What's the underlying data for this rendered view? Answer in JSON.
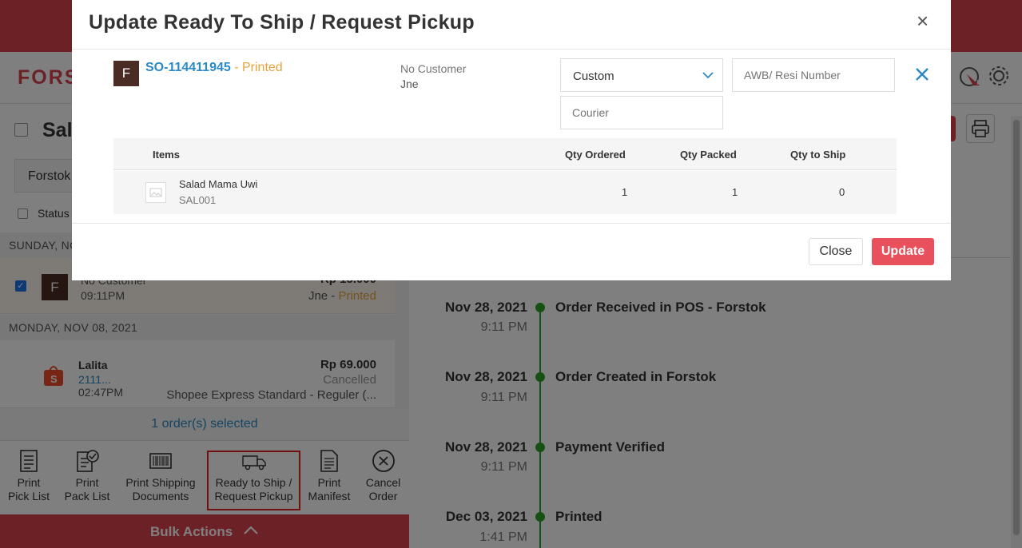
{
  "app": {
    "logo": "FORS"
  },
  "page": {
    "title": "Sal",
    "filter_value": "Forstok",
    "status_label": "Status"
  },
  "list": {
    "groups": [
      {
        "date": "SUNDAY, NC"
      },
      {
        "date": "MONDAY, NOV 08, 2021"
      }
    ],
    "orders": [
      {
        "avatar": "F",
        "customer": "No Customer",
        "time": "09:11PM",
        "amount": "Rp 15.000",
        "courier": "Jne",
        "status": "Printed"
      },
      {
        "customer": "Lalita",
        "order_id": "2111...",
        "time": "02:47PM",
        "amount": "Rp 69.000",
        "status": "Cancelled",
        "courier": "Shopee Express Standard - Reguler (..."
      }
    ],
    "selected_text": "1 order(s) selected"
  },
  "bulk": {
    "tools": [
      {
        "label1": "Print",
        "label2": "Pick List"
      },
      {
        "label1": "Print",
        "label2": "Pack List"
      },
      {
        "label1": "Print Shipping",
        "label2": "Documents"
      },
      {
        "label1": "Ready to Ship /",
        "label2": "Request Pickup"
      },
      {
        "label1": "Print",
        "label2": "Manifest"
      },
      {
        "label1": "Cancel",
        "label2": "Order"
      }
    ],
    "bar_label": "Bulk Actions"
  },
  "timeline": [
    {
      "date": "Nov 28, 2021",
      "time": "9:11 PM",
      "event": "Order Received in POS - Forstok"
    },
    {
      "date": "Nov 28, 2021",
      "time": "9:11 PM",
      "event": "Order Created in Forstok"
    },
    {
      "date": "Nov 28, 2021",
      "time": "9:11 PM",
      "event": "Payment Verified"
    },
    {
      "date": "Dec 03, 2021",
      "time": "1:41 PM",
      "event": "Printed"
    }
  ],
  "modal": {
    "title": "Update Ready To Ship / Request Pickup",
    "close_glyph": "×",
    "order": {
      "avatar": "F",
      "so_number": "SO-114411945",
      "separator": " - ",
      "status": "Printed",
      "customer": "No Customer",
      "courier": "Jne"
    },
    "form": {
      "shipping_select": "Custom",
      "awb_placeholder": "AWB/ Resi Number",
      "courier_placeholder": "Courier"
    },
    "table": {
      "headers": {
        "items": "Items",
        "qty_ordered": "Qty Ordered",
        "qty_packed": "Qty Packed",
        "qty_to_ship": "Qty to Ship"
      },
      "rows": [
        {
          "name": "Salad Mama Uwi",
          "sku": "SAL001",
          "qty_ordered": "1",
          "qty_packed": "1",
          "qty_to_ship": "0"
        }
      ]
    },
    "buttons": {
      "close": "Close",
      "update": "Update"
    }
  },
  "colors": {
    "brand": "#d9434f",
    "link": "#2a8ac7",
    "printed": "#e8a33d",
    "timeline": "#2aa12a",
    "update": "#e8505b"
  }
}
